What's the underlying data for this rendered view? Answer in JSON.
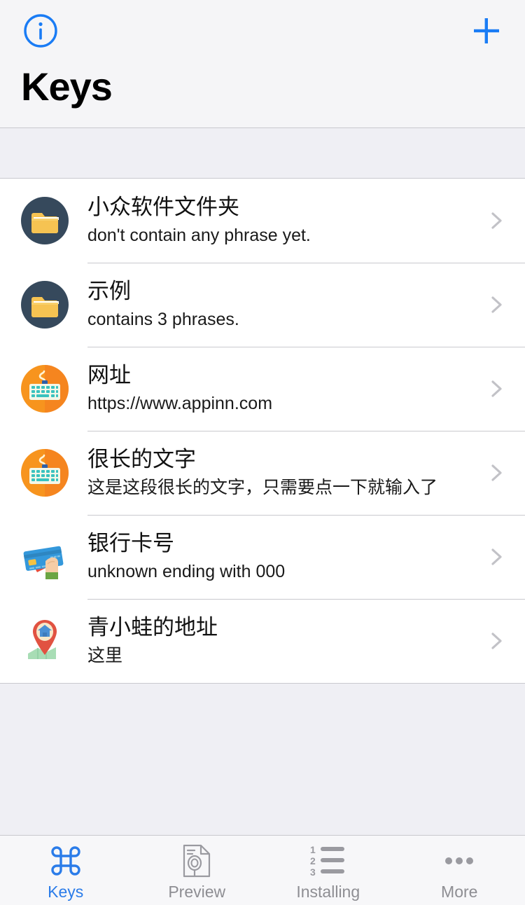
{
  "nav": {
    "title": "Keys",
    "info_button": "info-icon",
    "add_button": "plus-icon",
    "accent_color": "#1A7CF5"
  },
  "section": {
    "header_text": ""
  },
  "list": {
    "rows": [
      {
        "icon": "folder-icon",
        "title": "小众软件文件夹",
        "subtitle": "don't contain any phrase yet."
      },
      {
        "icon": "folder-icon",
        "title": "示例",
        "subtitle": "contains 3 phrases."
      },
      {
        "icon": "keyboard-icon",
        "title": "网址",
        "subtitle": "https://www.appinn.com"
      },
      {
        "icon": "keyboard-icon",
        "title": "很长的文字",
        "subtitle": "这是这段很长的文字，只需要点一下就输入了"
      },
      {
        "icon": "credit-card-icon",
        "title": "银行卡号",
        "subtitle": "unknown ending with 000"
      },
      {
        "icon": "map-pin-icon",
        "title": "青小蛙的地址",
        "subtitle": "这里"
      }
    ]
  },
  "tabbar": {
    "active_color": "#2B7CE9",
    "inactive_color": "#8E8E93",
    "tabs": [
      {
        "label": "Keys",
        "icon": "command-icon",
        "active": true
      },
      {
        "label": "Preview",
        "icon": "document-search-icon",
        "active": false
      },
      {
        "label": "Installing",
        "icon": "numbered-list-icon",
        "active": false
      },
      {
        "label": "More",
        "icon": "ellipsis-icon",
        "active": false
      }
    ]
  }
}
